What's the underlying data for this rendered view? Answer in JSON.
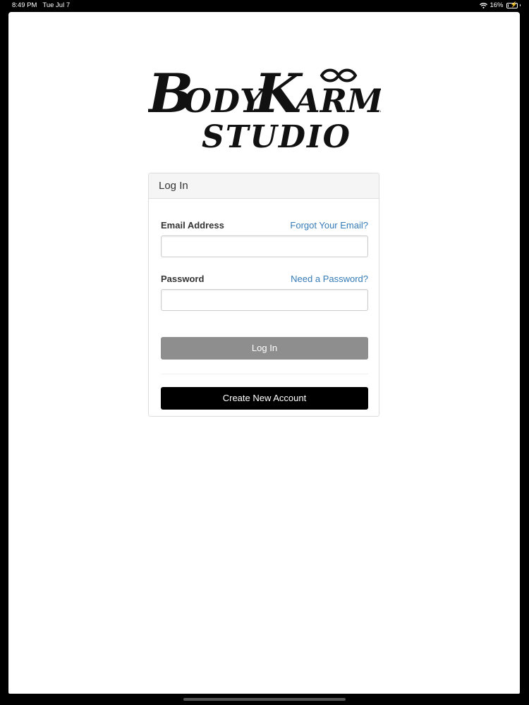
{
  "status_bar": {
    "time": "8:49 PM",
    "date": "Tue Jul 7",
    "battery_percent": "16%",
    "battery_level": 0.16,
    "icons": [
      "wifi-icon",
      "battery-icon",
      "charging-bolt-icon"
    ]
  },
  "logo": {
    "line1": "BODY KARMA",
    "line2": "STUDIO",
    "symbol": "infinity-icon"
  },
  "login_panel": {
    "heading": "Log In",
    "email_label": "Email Address",
    "forgot_email_link": "Forgot Your Email?",
    "email_value": "",
    "password_label": "Password",
    "need_password_link": "Need a Password?",
    "password_value": "",
    "login_button": "Log In",
    "create_account_button": "Create New Account"
  },
  "colors": {
    "link": "#337ab7",
    "login_button_bg": "#8e8e8f",
    "create_button_bg": "#000000",
    "panel_heading_bg": "#f5f5f5"
  }
}
